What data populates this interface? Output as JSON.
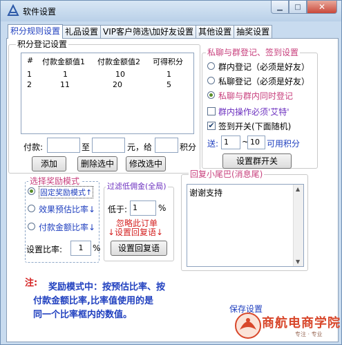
{
  "window": {
    "title": "软件设置"
  },
  "tabs": [
    "积分规则设置",
    "礼品设置",
    "VIP客户筛选\\加好友设置",
    "其他设置",
    "抽奖设置"
  ],
  "points_group": {
    "title": "积分登记设置",
    "table": {
      "headers": [
        "#",
        "付款金额值1",
        "付款金额值2",
        "可得积分"
      ],
      "rows": [
        [
          "1",
          "1",
          "10",
          "1"
        ],
        [
          "2",
          "11",
          "20",
          "5"
        ]
      ]
    },
    "pay_label": "付款:",
    "to_label": "至",
    "yuan_give_label": "元，给",
    "points_label": "积分",
    "add_button": "添加",
    "delete_button": "删除选中",
    "modify_button": "修改选中"
  },
  "group_reg": {
    "title": "私聊与群登记、签到设置",
    "options": [
      "群内登记（必须是好友）",
      "私聊登记（必须是好友）",
      "私聊与群内同时登记"
    ],
    "check_aite": "群内操作必须'艾特'",
    "check_signin": "签到开关(下面随机)",
    "send_label": "送:",
    "range_from": "1",
    "tilde": "~",
    "range_to": "10",
    "available_points": "可用积分",
    "set_keyword_button": "设置群开关"
  },
  "reward_group": {
    "title": "选择奖励模式",
    "options": [
      "固定奖励模式↑",
      "效果预估比率↓",
      "付款金额比率↓"
    ],
    "ratio_label": "设置比率:",
    "ratio_value": "1",
    "percent": "%"
  },
  "filter_group": {
    "title": "过滤低佣金(全局)",
    "below_label": "低于:",
    "below_value": "1",
    "percent": "%",
    "ignore_text": "忽略此订单",
    "reply_text": "↓设置回复语↓",
    "set_reply_button": "设置回复语"
  },
  "tail_group": {
    "title": "回复小尾巴(消息尾)",
    "content": "谢谢支持"
  },
  "note": {
    "prefix": "注:",
    "lines": [
      "奖励模式中：按预估比率、按",
      "付款金额比率,比率值使用的是",
      "同一个比率框内的数值。"
    ]
  },
  "save_button": "保存设置",
  "logo": {
    "name": "商航电商学院",
    "slogan": "专注 · 专业"
  }
}
